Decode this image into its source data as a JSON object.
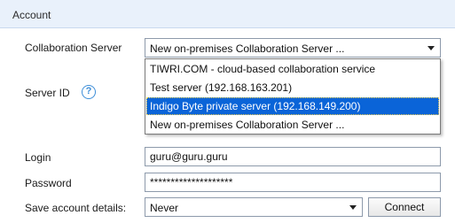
{
  "section": {
    "title": "Account"
  },
  "collab": {
    "label": "Collaboration Server",
    "selected": "New on-premises Collaboration Server ...",
    "options": [
      "TIWRI.COM - cloud-based collaboration service",
      "Test server (192.168.163.201)",
      "Indigo Byte private server (192.168.149.200)",
      "New on-premises Collaboration Server ..."
    ],
    "highlighted_index": 2
  },
  "server_id": {
    "label": "Server ID",
    "help_icon": "?"
  },
  "login": {
    "label": "Login",
    "value": "guru@guru.guru"
  },
  "password": {
    "label": "Password",
    "value": "********************"
  },
  "save_details": {
    "label": "Save account details:",
    "selected": "Never"
  },
  "connect_button": {
    "label": "Connect"
  },
  "colors": {
    "header_bg": "#e9f1fb",
    "accent": "#3d8ed8",
    "highlight": "#0a64d8"
  }
}
